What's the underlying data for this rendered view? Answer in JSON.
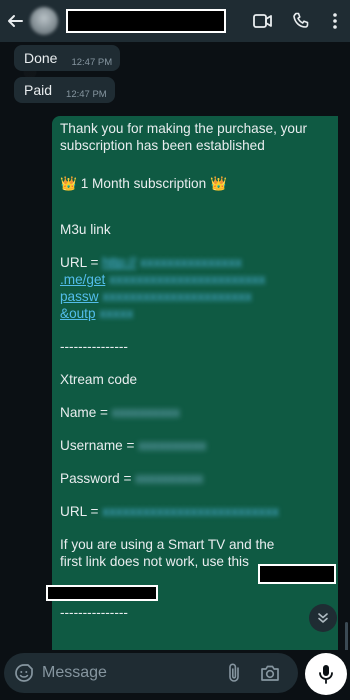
{
  "header": {
    "back_icon": "arrow-left-icon",
    "video_icon": "video-call-icon",
    "call_icon": "phone-icon",
    "menu_icon": "kebab-menu-icon"
  },
  "messages": {
    "incoming": [
      {
        "text": "Done",
        "time": "12:47 PM"
      },
      {
        "text": "Paid",
        "time": "12:47 PM"
      }
    ],
    "outgoing": {
      "thanks_1": "Thank you for making the purchase, your",
      "thanks_2": "subscription has been established",
      "crown": "👑",
      "plan": "1 Month subscription",
      "m3u_heading": "M3u link",
      "url_label": "URL =",
      "url_line1_end": "http://",
      "url_line2": ".me/get",
      "url_line3": "passw",
      "url_line4": "&outp",
      "divider": "---------------",
      "xtream_heading": "Xtream code",
      "name_label": "Name =",
      "username_label": "Username =",
      "password_label": "Password =",
      "url2_label": "URL =",
      "smart_tv_1": "If you are using a Smart TV and the",
      "smart_tv_2": "first link does not work, use this",
      "divider2": "---------------"
    }
  },
  "composer": {
    "placeholder": "Message",
    "emoji_icon": "sticker-emoji-icon",
    "attach_icon": "paperclip-icon",
    "camera_icon": "camera-icon",
    "mic_icon": "microphone-icon"
  },
  "colors": {
    "header_bg": "#1f2c33",
    "outgoing_bubble": "#0f5a43",
    "incoming_bubble": "#1f2c33",
    "link": "#53bdeb",
    "mic_button": "#ffffff"
  }
}
